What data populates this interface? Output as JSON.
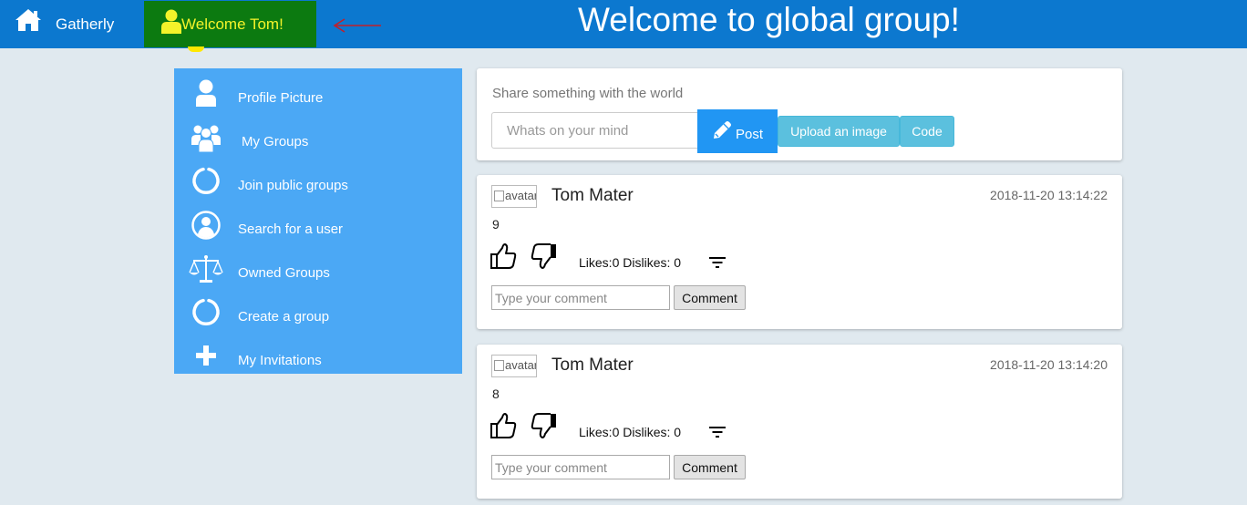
{
  "navbar": {
    "brand": "Gatherly",
    "welcome": "Welcome Tom!",
    "page_title": "Welcome to global group!"
  },
  "sidebar": {
    "items": [
      {
        "label": "Profile Picture",
        "icon": "user-icon"
      },
      {
        "label": "My Groups",
        "icon": "users-group-icon"
      },
      {
        "label": "Join public groups",
        "icon": "circle-notch-icon"
      },
      {
        "label": "Search for a user",
        "icon": "user-circle-icon"
      },
      {
        "label": "Owned Groups",
        "icon": "balance-scale-icon"
      },
      {
        "label": "Create a group",
        "icon": "circle-notch-icon"
      },
      {
        "label": "My Invitations",
        "icon": "plus-icon"
      }
    ]
  },
  "share": {
    "label": "Share something with the world",
    "placeholder": "Whats on your mind",
    "post_label": "Post",
    "upload_label": "Upload an image",
    "code_label": "Code"
  },
  "posts": [
    {
      "avatar_alt": "avatar",
      "author": "Tom Mater",
      "timestamp": "2018-11-20 13:14:22",
      "content": "9",
      "counts": "Likes:0 Dislikes: 0",
      "comment_placeholder": "Type your comment",
      "comment_label": "Comment"
    },
    {
      "avatar_alt": "avatar",
      "author": "Tom Mater",
      "timestamp": "2018-11-20 13:14:20",
      "content": "8",
      "counts": "Likes:0 Dislikes: 0",
      "comment_placeholder": "Type your comment",
      "comment_label": "Comment"
    }
  ],
  "colors": {
    "navbar": "#0c78cf",
    "welcome_highlight": "#0c7a10",
    "welcome_text": "#f3f32a",
    "sidebar": "#4ba8f5",
    "post_button": "#2196f3",
    "info_button": "#5bc0de",
    "annotation_arrow": "#c0202a",
    "background": "#e0e9ef"
  }
}
